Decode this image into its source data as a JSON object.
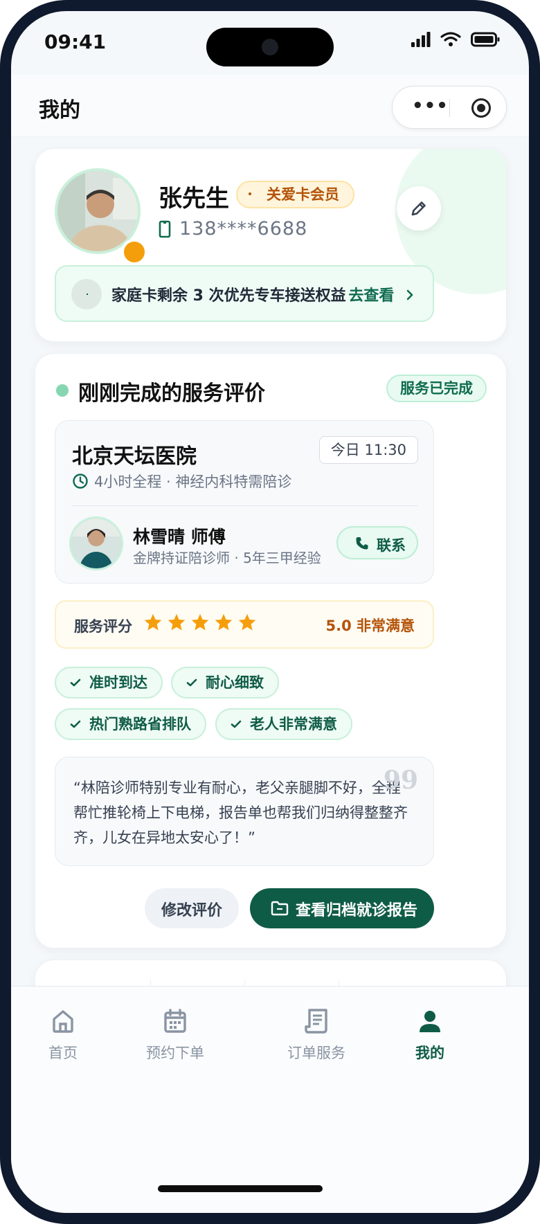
{
  "status_bar": {
    "time": "09:41"
  },
  "navbar": {
    "title": "我的"
  },
  "profile": {
    "name": "张先生",
    "member_badge": "关爱卡会员",
    "phone": "138****6688",
    "banner_text": "家庭卡剩余 3 次优先专车接送权益",
    "banner_link": "去查看"
  },
  "review": {
    "section_title": "刚刚完成的服务评价",
    "status_badge": "服务已完成",
    "hospital": "北京天坛医院",
    "time": "今日 11:30",
    "service_detail": "4小时全程 · 神经内科特需陪诊",
    "escort_name": "林雪晴 师傅",
    "escort_detail": "金牌持证陪诊师 · 5年三甲经验",
    "contact_label": "联系",
    "rating_label": "服务评分",
    "rating_stars": 5,
    "rating_value": "5.0 非常满意",
    "tags": [
      "准时到达",
      "耐心细致",
      "热门熟路省排队",
      "老人非常满意"
    ],
    "quote": "“林陪诊师特别专业有耐心，老父亲腿脚不好，全程帮忙推轮椅上下电梯，报告单也帮我们归纳得整整齐齐，儿女在异地太安心了！”",
    "quote_mark": "99",
    "modify_button": "修改评价",
    "report_button": "查看归档就诊报告"
  },
  "tabbar": {
    "items": [
      {
        "label": "首页",
        "icon": "home-icon",
        "active": false
      },
      {
        "label": "预约下单",
        "icon": "calendar-icon",
        "active": false
      },
      {
        "label": "订单服务",
        "icon": "receipt-icon",
        "active": false
      },
      {
        "label": "我的",
        "icon": "user-icon",
        "active": true
      }
    ]
  },
  "colors": {
    "brand": "#0f5c46",
    "accent_light": "#e8faf1",
    "gold": "#b45309",
    "star": "#f59e0b"
  }
}
